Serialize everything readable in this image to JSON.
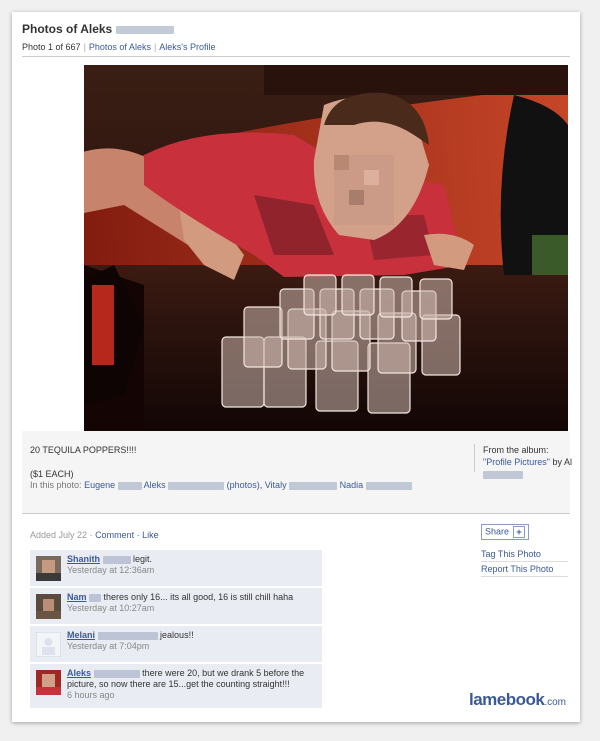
{
  "header": {
    "title": "Photos of Aleks",
    "photo_counter": "Photo 1 of 667",
    "link_photos": "Photos of Aleks",
    "link_profile": "Aleks's Profile"
  },
  "photo": {
    "description": "Young man in red t-shirt leaning over rows of tequila shot glasses on a dark table"
  },
  "caption": {
    "line1": "20 TEQUILA POPPERS!!!!",
    "line2": "($1 EACH)",
    "in_this_photo_label": "In this photo:",
    "tags": [
      "Eugene",
      "Aleks",
      "(photos),",
      "Vitaly",
      "Nadia"
    ]
  },
  "album": {
    "label": "From the album:",
    "name": "\"Profile Pictures\"",
    "by": "by Al"
  },
  "meta": {
    "added": "Added July 22 ·",
    "comment_link": "Comment",
    "like_link": "· Like"
  },
  "comments": [
    {
      "name": "Shanith",
      "text": "legit.",
      "time": "Yesterday at 12:36am"
    },
    {
      "name": "Nam",
      "text": "theres only 16... its all good, 16 is still chill haha",
      "time": "Yesterday at 10:27am"
    },
    {
      "name": "Melani",
      "text": "jealous!!",
      "time": "Yesterday at 7:04pm"
    },
    {
      "name": "Aleks",
      "text": "there were 20, but we drank 5 before the picture, so now there are 15...get the counting straight!!!",
      "time": "6 hours ago"
    }
  ],
  "sidebar": {
    "share": "Share",
    "tag": "Tag This Photo",
    "report": "Report This Photo"
  },
  "watermark": {
    "brand": "lamebook",
    "tld": ".com"
  }
}
